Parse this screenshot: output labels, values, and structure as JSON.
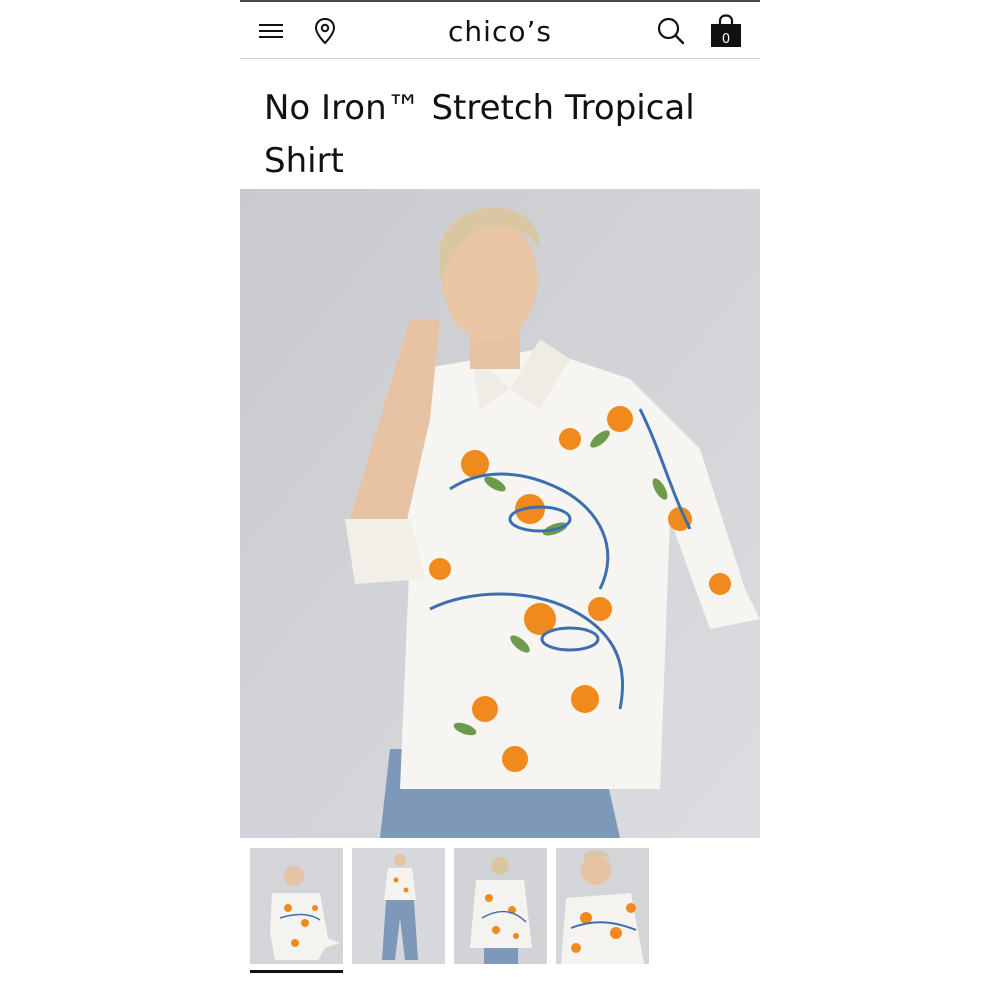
{
  "header": {
    "logo_text": "chico’s",
    "bag_count": "0",
    "icons": [
      "menu-icon",
      "location-pin-icon",
      "search-icon",
      "shopping-bag-icon"
    ]
  },
  "product": {
    "title": "No Iron™ Stretch Tropical Shirt"
  },
  "gallery": {
    "thumbnail_count": 4,
    "selected_thumbnail": 1
  },
  "colors": {
    "text": "#111111",
    "background": "#ffffff",
    "divider": "#cfcfcf",
    "photo_backdrop": "#cfd0d4",
    "accent_orange": "#f08a1c",
    "accent_blue": "#3d6fb0"
  }
}
